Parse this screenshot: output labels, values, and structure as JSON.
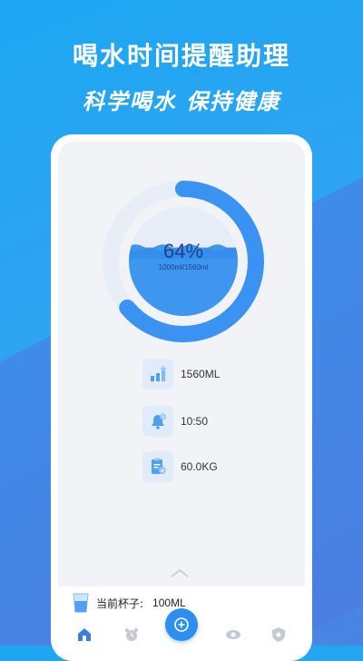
{
  "headline": "喝水时间提醒助理",
  "subline": "科学喝水 保持健康",
  "progress": {
    "percent_text": "64%",
    "fraction": 0.64,
    "ratio_text": "1000ml/1560ml"
  },
  "stats": [
    {
      "icon": "goal-chart-icon",
      "value": "1560ML"
    },
    {
      "icon": "bell-clock-icon",
      "value": "10:50"
    },
    {
      "icon": "clipboard-scale-icon",
      "value": "60.0KG"
    }
  ],
  "cup": {
    "label": "当前杯子:",
    "value": "100ML",
    "icon": "cup-icon"
  },
  "nav": [
    "home-icon",
    "alarm-clock-icon",
    "add-record-icon",
    "eye-icon",
    "shield-icon"
  ],
  "colors": {
    "accent": "#3a93f2",
    "ring_track": "#eaf2fc",
    "water": "#3f96ef",
    "text_dark": "#1f3f8f"
  }
}
